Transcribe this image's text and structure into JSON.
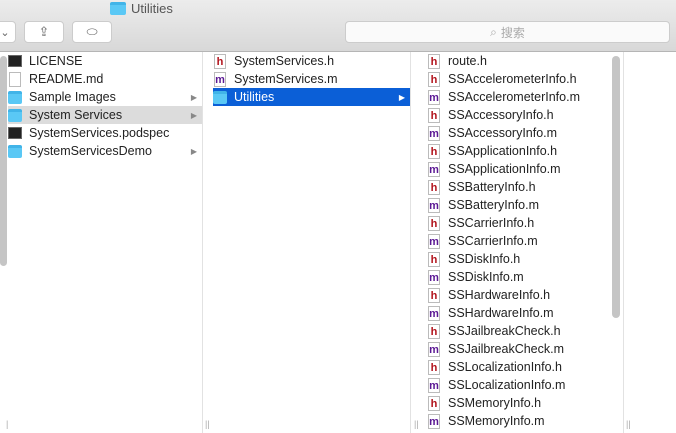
{
  "window": {
    "title": "Utilities"
  },
  "toolbar": {
    "view_chevron": "⌄",
    "share": "⇪",
    "tag": "⬭",
    "search_placeholder": "搜索"
  },
  "columns": [
    {
      "items": [
        {
          "name": "LICENSE",
          "type": "terminal"
        },
        {
          "name": "README.md",
          "type": "doc"
        },
        {
          "name": "Sample Images",
          "type": "folder",
          "arrow": true
        },
        {
          "name": "System Services",
          "type": "folder",
          "arrow": true,
          "selected": "gray"
        },
        {
          "name": "SystemServices.podspec",
          "type": "terminal"
        },
        {
          "name": "SystemServicesDemo",
          "type": "folder",
          "arrow": true
        }
      ]
    },
    {
      "items": [
        {
          "name": "SystemServices.h",
          "type": "h"
        },
        {
          "name": "SystemServices.m",
          "type": "m"
        },
        {
          "name": "Utilities",
          "type": "folder",
          "arrow": true,
          "selected": "blue"
        }
      ]
    },
    {
      "items": [
        {
          "name": "route.h",
          "type": "h"
        },
        {
          "name": "SSAccelerometerInfo.h",
          "type": "h"
        },
        {
          "name": "SSAccelerometerInfo.m",
          "type": "m"
        },
        {
          "name": "SSAccessoryInfo.h",
          "type": "h"
        },
        {
          "name": "SSAccessoryInfo.m",
          "type": "m"
        },
        {
          "name": "SSApplicationInfo.h",
          "type": "h"
        },
        {
          "name": "SSApplicationInfo.m",
          "type": "m"
        },
        {
          "name": "SSBatteryInfo.h",
          "type": "h"
        },
        {
          "name": "SSBatteryInfo.m",
          "type": "m"
        },
        {
          "name": "SSCarrierInfo.h",
          "type": "h"
        },
        {
          "name": "SSCarrierInfo.m",
          "type": "m"
        },
        {
          "name": "SSDiskInfo.h",
          "type": "h"
        },
        {
          "name": "SSDiskInfo.m",
          "type": "m"
        },
        {
          "name": "SSHardwareInfo.h",
          "type": "h"
        },
        {
          "name": "SSHardwareInfo.m",
          "type": "m"
        },
        {
          "name": "SSJailbreakCheck.h",
          "type": "h"
        },
        {
          "name": "SSJailbreakCheck.m",
          "type": "m"
        },
        {
          "name": "SSLocalizationInfo.h",
          "type": "h"
        },
        {
          "name": "SSLocalizationInfo.m",
          "type": "m"
        },
        {
          "name": "SSMemoryInfo.h",
          "type": "h"
        },
        {
          "name": "SSMemoryInfo.m",
          "type": "m"
        }
      ]
    }
  ],
  "colors": {
    "selection": "#0b5fd7",
    "folder": "#5ac8f5"
  }
}
